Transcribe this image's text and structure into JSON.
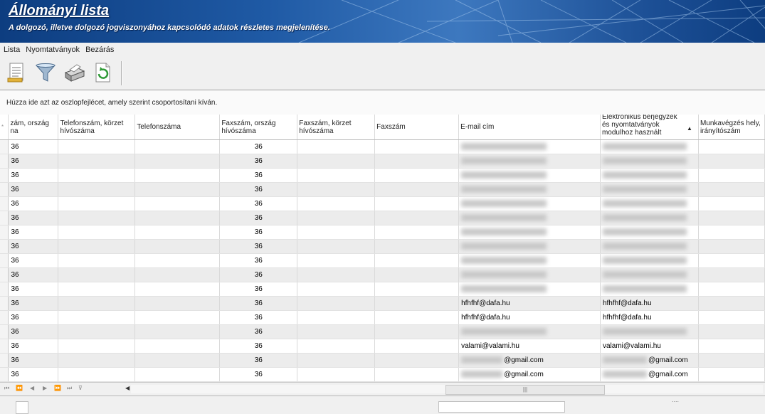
{
  "header": {
    "title": "Állományi lista",
    "subtitle": "A dolgozó, illetve dolgozó jogviszonyához kapcsolódó adatok részletes megjelenítése."
  },
  "menu": [
    "Lista",
    "Nyomtatványok",
    "Bezárás"
  ],
  "toolbar": {
    "icons": [
      "document-list-icon",
      "filter-funnel-icon",
      "printer-icon",
      "refresh-icon"
    ]
  },
  "group_panel": {
    "hint": "Húzza ide azt az oszlopfejlécet, amely szerint csoportosítani kíván."
  },
  "grid": {
    "columns": [
      "zám, ország\nna",
      "Telefonszám, körzet\nhívószáma",
      "Telefonszáma",
      "Faxszám, ország\nhívószáma",
      "Faxszám, körzet\nhívószáma",
      "Faxszám",
      "E-mail cím",
      "Elektronikus berjegyzék\nés nyomtatványok\nmodulhoz használt",
      "Munkavégzés hely,\nirányítószám"
    ],
    "sort_indicator": "▲",
    "rows": [
      {
        "c1": "36",
        "fax": "36",
        "email": "",
        "email2": ""
      },
      {
        "c1": "36",
        "fax": "36",
        "email": "",
        "email2": ""
      },
      {
        "c1": "36",
        "fax": "36",
        "email": "",
        "email2": ""
      },
      {
        "c1": "36",
        "fax": "36",
        "email": "",
        "email2": ""
      },
      {
        "c1": "36",
        "fax": "36",
        "email": "",
        "email2": ""
      },
      {
        "c1": "36",
        "fax": "36",
        "email": "",
        "email2": ""
      },
      {
        "c1": "36",
        "fax": "36",
        "email": "",
        "email2": ""
      },
      {
        "c1": "36",
        "fax": "36",
        "email": "",
        "email2": ""
      },
      {
        "c1": "36",
        "fax": "36",
        "email": "",
        "email2": ""
      },
      {
        "c1": "36",
        "fax": "36",
        "email": "",
        "email2": ""
      },
      {
        "c1": "36",
        "fax": "36",
        "email": "",
        "email2": ""
      },
      {
        "c1": "36",
        "fax": "36",
        "email": "hfhfhf@dafa.hu",
        "email2": "hfhfhf@dafa.hu"
      },
      {
        "c1": "36",
        "fax": "36",
        "email": "hfhfhf@dafa.hu",
        "email2": "hfhfhf@dafa.hu"
      },
      {
        "c1": "36",
        "fax": "36",
        "email": "",
        "email2": ""
      },
      {
        "c1": "36",
        "fax": "36",
        "email": "valami@valami.hu",
        "email2": "valami@valami.hu"
      },
      {
        "c1": "36",
        "fax": "36",
        "email": "@gmail.com",
        "email2": "@gmail.com"
      },
      {
        "c1": "36",
        "fax": "36",
        "email": "@gmail.com",
        "email2": "@gmail.com"
      }
    ]
  },
  "navigator": {
    "buttons": [
      "⏮",
      "⏪",
      "◀",
      "▶",
      "⏩",
      "⏭",
      "⊽"
    ],
    "scroll_thumb": "|||"
  },
  "statusbar": {
    "grip": "...."
  }
}
